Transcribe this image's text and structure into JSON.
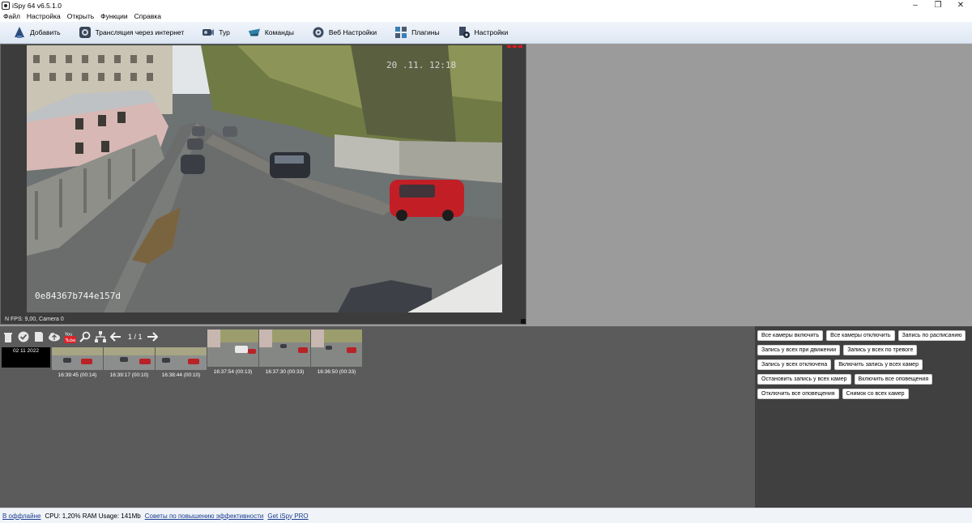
{
  "window": {
    "title": "iSpy 64 v6.5.1.0",
    "minimize": "–",
    "maximize": "❐",
    "close": "✕"
  },
  "menu": [
    "Файл",
    "Настройка",
    "Открыть",
    "Функции",
    "Справка"
  ],
  "toolbar": [
    {
      "icon": "add-icon",
      "label": "Добавить"
    },
    {
      "icon": "broadcast-icon",
      "label": "Трансляция через интернет"
    },
    {
      "icon": "tour-icon",
      "label": "Тур"
    },
    {
      "icon": "commands-icon",
      "label": "Команды"
    },
    {
      "icon": "web-settings-icon",
      "label": "Веб Настройки"
    },
    {
      "icon": "plugins-icon",
      "label": "Плагины"
    },
    {
      "icon": "settings-icon",
      "label": "Настройки"
    }
  ],
  "camera": {
    "overlay_id": "0e84367b744e157d",
    "overlay_timestamp": "20  .11.      12:18",
    "footer": "N   FPS: 9,00, Camera 0"
  },
  "media_bar": {
    "page": "1 / 1",
    "date_label": "02 11 2022",
    "thumbnails": [
      {
        "caption": "16:39:45 (00:14)"
      },
      {
        "caption": "16:39:17 (00:10)"
      },
      {
        "caption": "16:38:44 (00:10)"
      },
      {
        "caption": "16:37:54 (00:13)"
      },
      {
        "caption": "16:37:30 (00:33)"
      },
      {
        "caption": "16:36:50 (00:33)"
      }
    ]
  },
  "actions": {
    "row1": [
      "Все камеры включить",
      "Все камеры отключить",
      "Запись по расписанию"
    ],
    "row2": [
      "Запись у всех при движении",
      "Запись у всех по тревоге"
    ],
    "row3": [
      "Запись у всех отключена",
      "Включить запись у всех камер"
    ],
    "row4": [
      "Остановить запись у всех камер",
      "Включить все оповещения"
    ],
    "row5": [
      "Отключить все оповещения",
      "Снимок со всех камер"
    ]
  },
  "status": {
    "offline": "В оффлайне",
    "usage": "CPU: 1,20% RAM Usage: 141Mb",
    "tips": "Советы по повышению эффективности",
    "pro": "Get iSpy PRO"
  }
}
